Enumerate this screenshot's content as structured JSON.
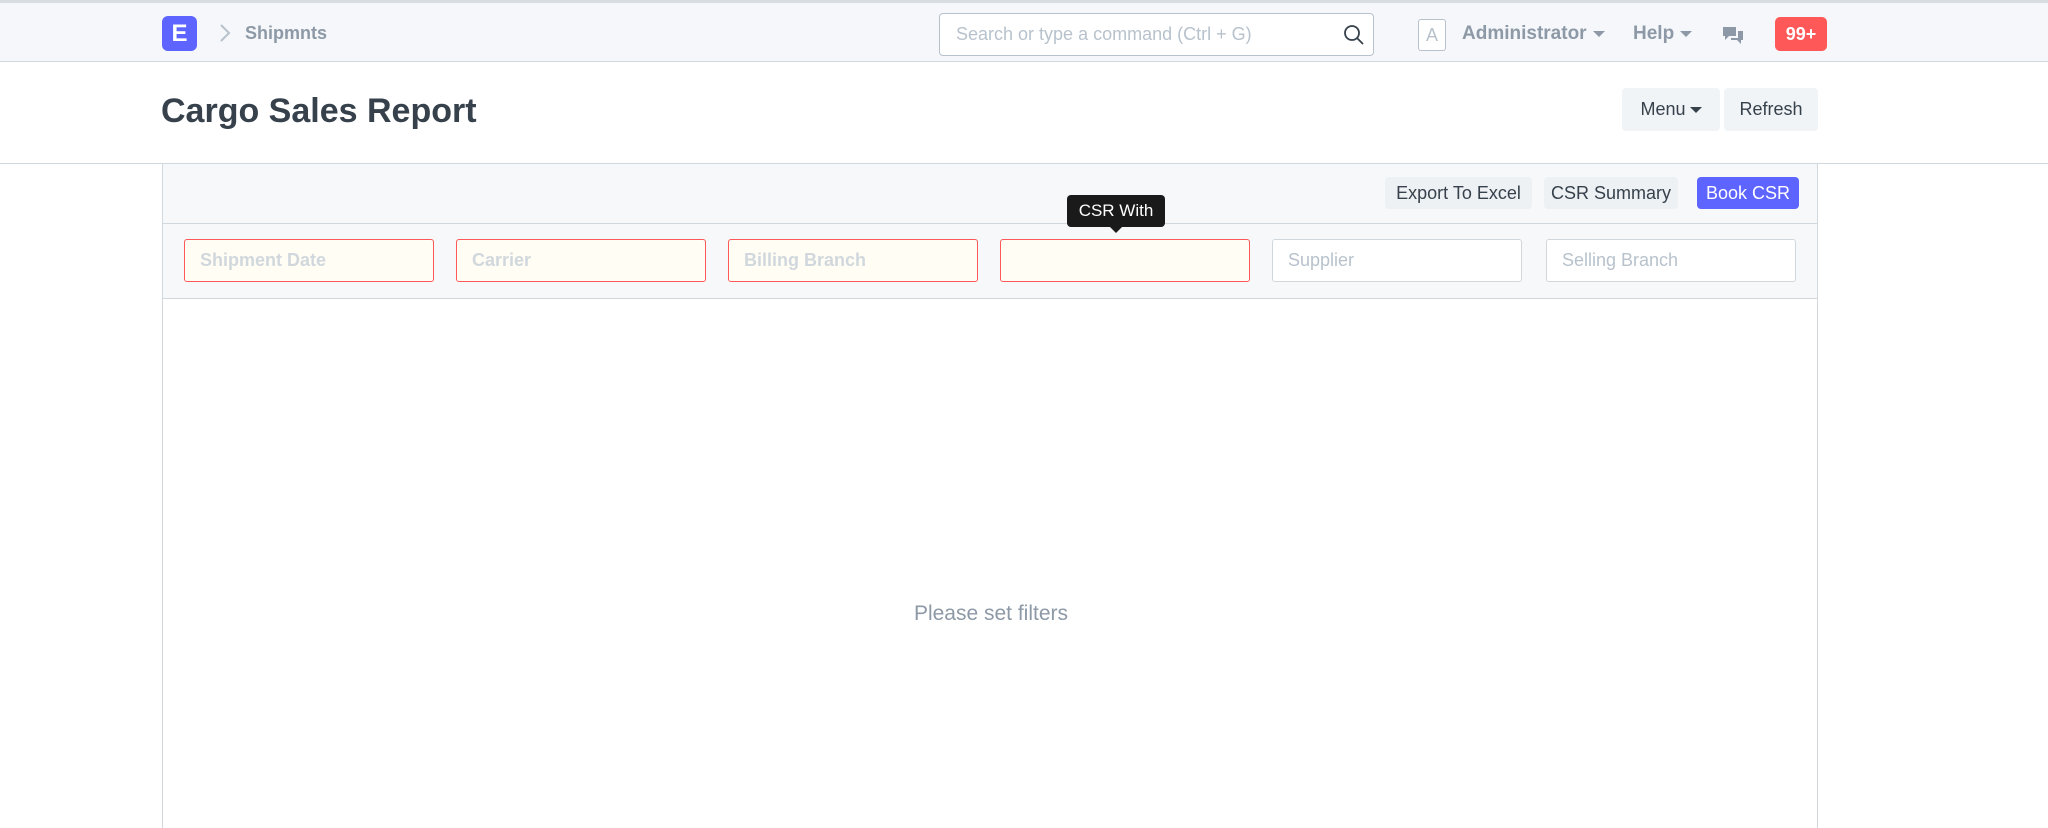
{
  "navbar": {
    "logo_letter": "E",
    "breadcrumb": "Shipmnts",
    "search_placeholder": "Search or type a command (Ctrl + G)",
    "avatar_letter": "A",
    "user_name": "Administrator",
    "help_label": "Help",
    "notification_count": "99+"
  },
  "page": {
    "title": "Cargo Sales Report",
    "menu_label": "Menu",
    "refresh_label": "Refresh"
  },
  "toolbar": {
    "export_label": "Export To Excel",
    "summary_label": "CSR Summary",
    "book_label": "Book CSR"
  },
  "filters": {
    "shipment_date": "Shipment Date",
    "carrier": "Carrier",
    "billing_branch": "Billing Branch",
    "csr_with": "",
    "supplier": "Supplier",
    "selling_branch": "Selling Branch",
    "tooltip": "CSR With"
  },
  "report": {
    "empty_message": "Please set filters"
  },
  "colors": {
    "primary": "#5e64ff",
    "danger": "#ff5858",
    "muted_text": "#8d99a6"
  }
}
